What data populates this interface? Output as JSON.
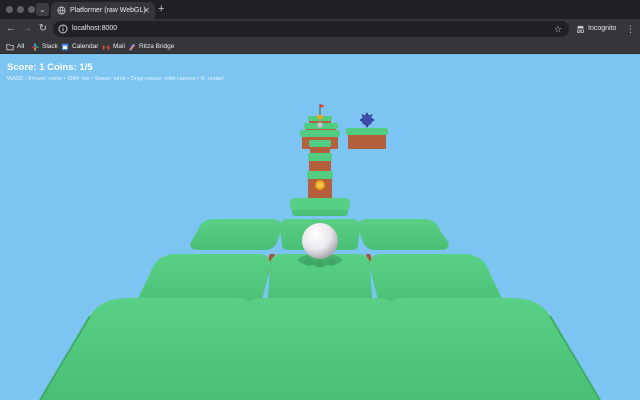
{
  "browser": {
    "tab_title": "Platformer (raw WebGL)",
    "tab_close": "✕",
    "new_tab": "+",
    "url": "localhost:8000",
    "incognito_label": "Incognito",
    "bookmarks": [
      {
        "label": "All",
        "icon": "folder-icon"
      },
      {
        "label": "Slack",
        "icon": "slack-icon"
      },
      {
        "label": "Calendar",
        "icon": "calendar-icon"
      },
      {
        "label": "Mail",
        "icon": "gmail-icon"
      },
      {
        "label": "Ritza Bridge",
        "icon": "ritza-icon"
      }
    ]
  },
  "hud": {
    "score_line": "Score: 1 Coins: 1/5",
    "controls": "WASD / Arrows: move  •  Shift: run  •  Space: jump  •  Drag mouse: orbit camera  •  R: restart"
  },
  "colors": {
    "sky": "#7cc4f2",
    "grass": "#52cc80",
    "dirt": "#b5603c",
    "coin": "#f0a020",
    "enemy": "#3d4da8",
    "player": "#f4f4f6"
  }
}
